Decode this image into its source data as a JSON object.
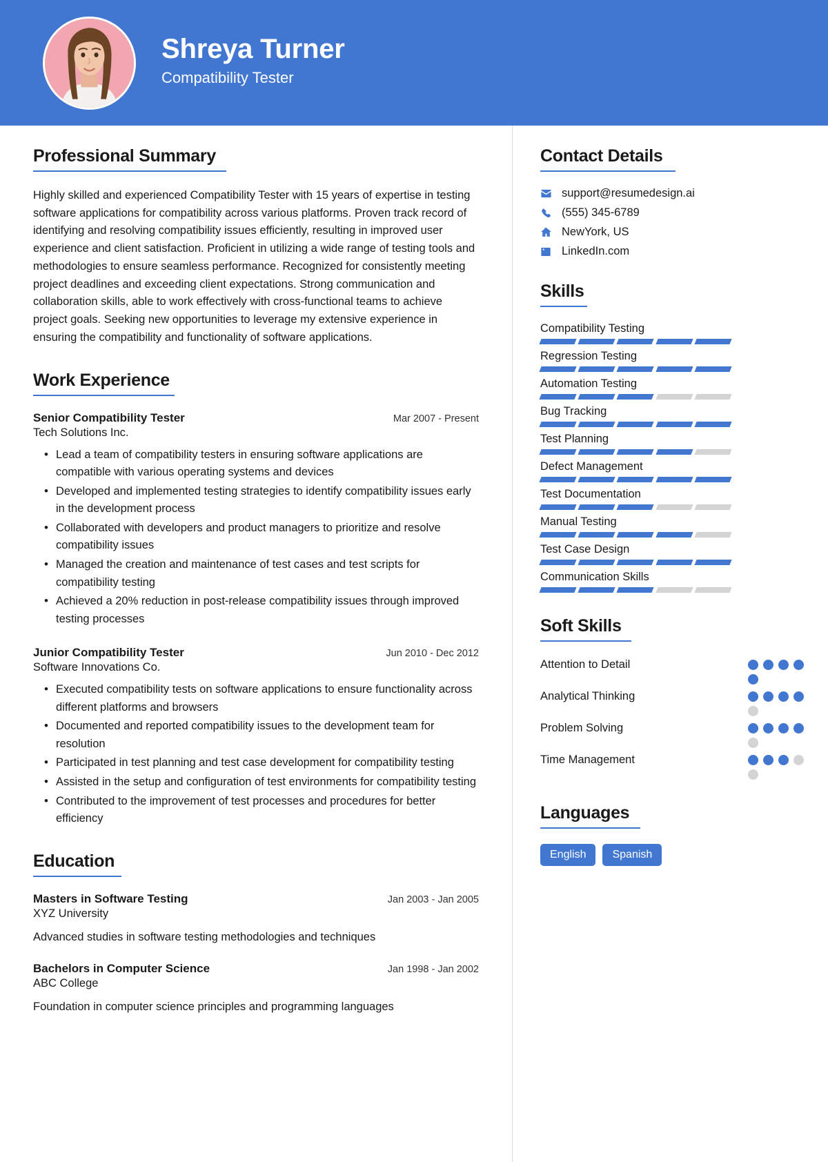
{
  "theme": {
    "accent": "#4277d1",
    "muted": "#d4d4d4",
    "avatar_bg": "#f2a6b0"
  },
  "header": {
    "name": "Shreya Turner",
    "role": "Compatibility Tester"
  },
  "summary": {
    "title": "Professional Summary",
    "text": "Highly skilled and experienced Compatibility Tester with 15 years of expertise in testing software applications for compatibility across various platforms. Proven track record of identifying and resolving compatibility issues efficiently, resulting in improved user experience and client satisfaction. Proficient in utilizing a wide range of testing tools and methodologies to ensure seamless performance. Recognized for consistently meeting project deadlines and exceeding client expectations. Strong communication and collaboration skills, able to work effectively with cross-functional teams to achieve project goals. Seeking new opportunities to leverage my extensive experience in ensuring the compatibility and functionality of software applications."
  },
  "work": {
    "title": "Work Experience",
    "jobs": [
      {
        "title": "Senior Compatibility Tester",
        "dates": "Mar 2007 - Present",
        "company": "Tech Solutions Inc.",
        "bullets": [
          "Lead a team of compatibility testers in ensuring software applications are compatible with various operating systems and devices",
          "Developed and implemented testing strategies to identify compatibility issues early in the development process",
          "Collaborated with developers and product managers to prioritize and resolve compatibility issues",
          "Managed the creation and maintenance of test cases and test scripts for compatibility testing",
          "Achieved a 20% reduction in post-release compatibility issues through improved testing processes"
        ]
      },
      {
        "title": "Junior Compatibility Tester",
        "dates": "Jun 2010 - Dec 2012",
        "company": "Software Innovations Co.",
        "bullets": [
          "Executed compatibility tests on software applications to ensure functionality across different platforms and browsers",
          "Documented and reported compatibility issues to the development team for resolution",
          "Participated in test planning and test case development for compatibility testing",
          "Assisted in the setup and configuration of test environments for compatibility testing",
          "Contributed to the improvement of test processes and procedures for better efficiency"
        ]
      }
    ]
  },
  "education": {
    "title": "Education",
    "items": [
      {
        "degree": "Masters in Software Testing",
        "dates": "Jan 2003 - Jan 2005",
        "school": "XYZ University",
        "desc": "Advanced studies in software testing methodologies and techniques"
      },
      {
        "degree": "Bachelors in Computer Science",
        "dates": "Jan 1998 - Jan 2002",
        "school": "ABC College",
        "desc": "Foundation in computer science principles and programming languages"
      }
    ]
  },
  "contact": {
    "title": "Contact Details",
    "items": [
      {
        "icon": "envelope-icon",
        "value": "support@resumedesign.ai"
      },
      {
        "icon": "phone-icon",
        "value": "(555) 345-6789"
      },
      {
        "icon": "home-icon",
        "value": "NewYork, US"
      },
      {
        "icon": "linkedin-icon",
        "value": "LinkedIn.com"
      }
    ]
  },
  "skills": {
    "title": "Skills",
    "total_segments": 5,
    "items": [
      {
        "label": "Compatibility Testing",
        "filled": 5
      },
      {
        "label": "Regression Testing",
        "filled": 5
      },
      {
        "label": "Automation Testing",
        "filled": 3
      },
      {
        "label": "Bug Tracking",
        "filled": 5
      },
      {
        "label": "Test Planning",
        "filled": 4
      },
      {
        "label": "Defect Management",
        "filled": 5
      },
      {
        "label": "Test Documentation",
        "filled": 3
      },
      {
        "label": "Manual Testing",
        "filled": 4
      },
      {
        "label": "Test Case Design",
        "filled": 5
      },
      {
        "label": "Communication Skills",
        "filled": 3
      }
    ]
  },
  "soft_skills": {
    "title": "Soft Skills",
    "total_dots": 5,
    "items": [
      {
        "label": "Attention to Detail",
        "filled": 5
      },
      {
        "label": "Analytical Thinking",
        "filled": 4
      },
      {
        "label": "Problem Solving",
        "filled": 4
      },
      {
        "label": "Time Management",
        "filled": 3
      }
    ]
  },
  "languages": {
    "title": "Languages",
    "items": [
      "English",
      "Spanish"
    ]
  }
}
